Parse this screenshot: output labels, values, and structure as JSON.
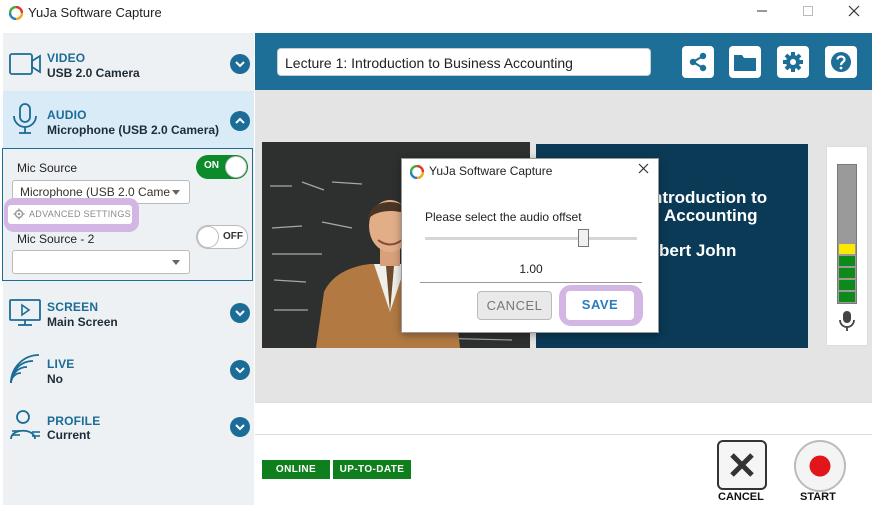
{
  "window": {
    "title": "YuJa Software Capture",
    "minimize_icon": "minimize-icon",
    "maximize_icon": "maximize-icon",
    "close_icon": "close-icon"
  },
  "sidebar": {
    "video": {
      "title": "VIDEO",
      "subtitle": "USB 2.0 Camera",
      "icon": "video-camera-icon"
    },
    "audio": {
      "title": "AUDIO",
      "subtitle": "Microphone (USB 2.0 Camera)",
      "icon": "microphone-icon",
      "mic_source_label": "Mic Source",
      "mic_source_toggle": "ON",
      "mic_source_value": "Microphone (USB 2.0 Came",
      "advanced_settings_label": "ADVANCED SETTINGS",
      "mic_source2_label": "Mic Source - 2",
      "mic_source2_toggle": "OFF",
      "mic_source2_value": ""
    },
    "screen": {
      "title": "SCREEN",
      "subtitle": "Main Screen",
      "icon": "screen-icon"
    },
    "live": {
      "title": "LIVE",
      "subtitle": "No",
      "icon": "live-broadcast-icon"
    },
    "profile": {
      "title": "PROFILE",
      "subtitle": "Current",
      "icon": "profile-icon"
    }
  },
  "toolbar": {
    "recording_title": "Lecture 1: Introduction to Business Accounting",
    "share_icon": "share-icon",
    "folder_icon": "folder-icon",
    "settings_icon": "gear-icon",
    "help_icon": "help-icon"
  },
  "preview": {
    "slide_line1": "ntroduction to",
    "slide_line2": "Accounting",
    "slide_line3": "bert John"
  },
  "status": {
    "online": "ONLINE",
    "up_to_date": "UP-TO-DATE"
  },
  "actions": {
    "cancel_label": "CANCEL",
    "start_label": "START"
  },
  "dialog": {
    "title": "YuJa Software Capture",
    "prompt": "Please select the audio offset",
    "offset_value": "1.00",
    "cancel_label": "CANCEL",
    "save_label": "SAVE"
  },
  "colors": {
    "brand_blue": "#1d6f97",
    "online_green": "#0f7f1e",
    "highlight_purple": "#d3b6e3",
    "record_red": "#e0161b"
  }
}
